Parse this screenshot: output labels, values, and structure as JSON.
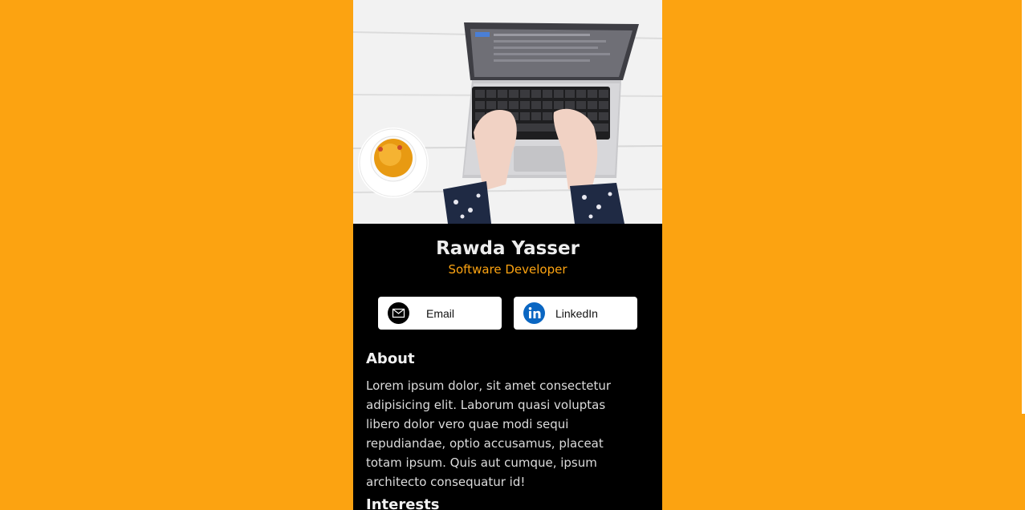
{
  "profile": {
    "name": "Rawda Yasser",
    "title": "Software Developer"
  },
  "buttons": {
    "email_label": "Email",
    "linkedin_label": "LinkedIn"
  },
  "about": {
    "heading": "About",
    "text": "Lorem ipsum dolor, sit amet consectetur adipisicing elit. Laborum quasi voluptas libero dolor vero quae modi sequi repudiandae, optio accusamus, placeat totam ipsum. Quis aut cumque, ipsum architecto consequatur id!"
  },
  "interests": {
    "heading": "Interests"
  },
  "colors": {
    "page_background": "#fca311",
    "card_background": "#000000",
    "accent": "#fca311",
    "linkedin_blue": "#0a66c2"
  },
  "icons": [
    "envelope-icon",
    "linkedin-icon"
  ]
}
